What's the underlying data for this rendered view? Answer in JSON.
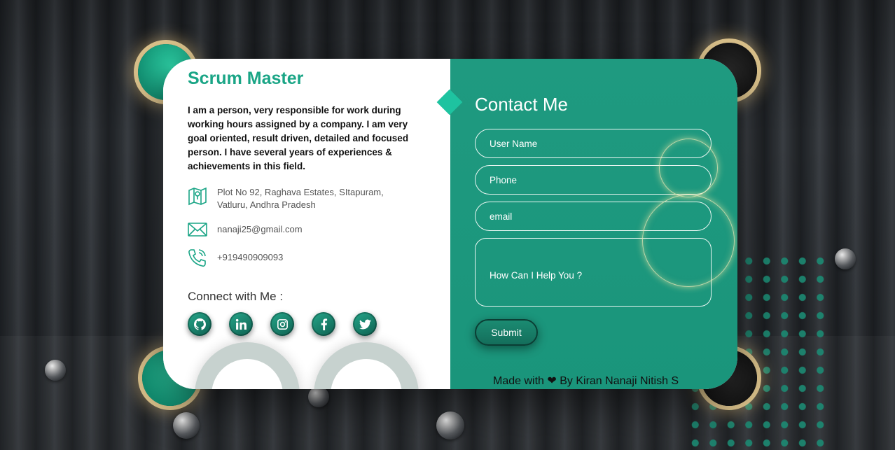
{
  "profile": {
    "title": "Scrum Master",
    "about": "I am a person, very responsible for work during working hours assigned by a company. I am very goal oriented, result driven, detailed and focused person. I have several years of experiences & achievements in this field."
  },
  "info": {
    "address": "Plot No 92, Raghava Estates, SItapuram, Vatluru, Andhra Pradesh",
    "email": "nanaji25@gmail.com",
    "phone": "+919490909093"
  },
  "connect": {
    "label": "Connect with Me :",
    "icons": [
      "github-icon",
      "linkedin-icon",
      "instagram-icon",
      "facebook-icon",
      "twitter-icon"
    ]
  },
  "contact": {
    "title": "Contact Me",
    "username_placeholder": "User Name",
    "phone_placeholder": "Phone",
    "email_placeholder": "email",
    "message_placeholder": "How Can I Help You ?",
    "submit_label": "Submit"
  },
  "footer": {
    "prefix": "Made with",
    "suffix": "By Kiran Nanaji Nitish S"
  },
  "colors": {
    "accent": "#1aa586",
    "panel": "#1f9a80"
  }
}
